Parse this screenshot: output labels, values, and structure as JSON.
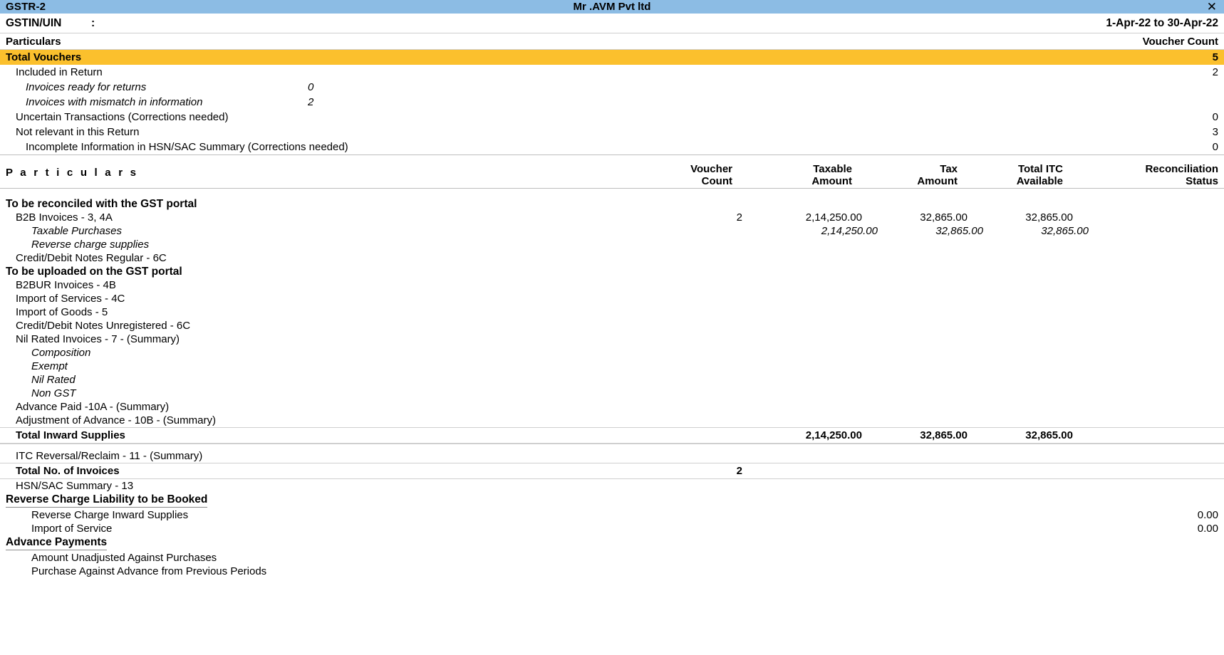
{
  "titlebar": {
    "report_name": "GSTR-2",
    "company": "Mr .AVM  Pvt ltd",
    "close_icon": "close-icon",
    "close_glyph": "✕"
  },
  "header": {
    "gstin_label": "GSTIN/UIN",
    "gstin_colon": ":",
    "gstin_value": "",
    "period": "1-Apr-22 to 30-Apr-22",
    "particulars_label": "Particulars",
    "voucher_count_label": "Voucher Count"
  },
  "summary": {
    "total_vouchers": {
      "label": "Total Vouchers",
      "value": "5"
    },
    "rows": [
      {
        "label": "Included in Return",
        "indent": 1,
        "italic": false,
        "sub_value": "",
        "value": "2"
      },
      {
        "label": "Invoices ready for returns",
        "indent": 2,
        "italic": true,
        "sub_value": "0",
        "value": ""
      },
      {
        "label": "Invoices with mismatch in information",
        "indent": 2,
        "italic": true,
        "sub_value": "2",
        "value": ""
      },
      {
        "label": "Uncertain Transactions (Corrections needed)",
        "indent": 1,
        "italic": false,
        "sub_value": "",
        "value": "0"
      },
      {
        "label": "Not relevant in this Return",
        "indent": 1,
        "italic": false,
        "sub_value": "",
        "value": "3"
      },
      {
        "label": "Incomplete Information in HSN/SAC Summary (Corrections needed)",
        "indent": 2,
        "italic": false,
        "sub_value": "",
        "value": "0"
      }
    ]
  },
  "table": {
    "columns": {
      "particulars": "P a r t i c u l a r s",
      "voucher_count_l1": "Voucher",
      "voucher_count_l2": "Count",
      "taxable_amount_l1": "Taxable",
      "taxable_amount_l2": "Amount",
      "tax_amount_l1": "Tax",
      "tax_amount_l2": "Amount",
      "total_itc_l1": "Total ITC",
      "total_itc_l2": "Available",
      "reconciliation_l1": "Reconciliation",
      "reconciliation_l2": "Status"
    },
    "rows": [
      {
        "label": "To be reconciled with the GST portal",
        "style": "bold",
        "indent": 0,
        "vc": "",
        "taxable": "",
        "tax": "",
        "itc": "",
        "recon": ""
      },
      {
        "label": "B2B Invoices - 3, 4A",
        "style": "normal",
        "indent": 1,
        "vc": "2",
        "taxable": "2,14,250.00",
        "tax": "32,865.00",
        "itc": "32,865.00",
        "recon": ""
      },
      {
        "label": "Taxable Purchases",
        "style": "italic",
        "indent": 2,
        "vc": "",
        "taxable": "2,14,250.00",
        "tax": "32,865.00",
        "itc": "32,865.00",
        "recon": ""
      },
      {
        "label": "Reverse charge supplies",
        "style": "italic",
        "indent": 2,
        "vc": "",
        "taxable": "",
        "tax": "",
        "itc": "",
        "recon": ""
      },
      {
        "label": "Credit/Debit Notes Regular - 6C",
        "style": "normal",
        "indent": 1,
        "vc": "",
        "taxable": "",
        "tax": "",
        "itc": "",
        "recon": ""
      },
      {
        "label": "To be uploaded on the GST portal",
        "style": "bold",
        "indent": 0,
        "vc": "",
        "taxable": "",
        "tax": "",
        "itc": "",
        "recon": ""
      },
      {
        "label": "B2BUR Invoices - 4B",
        "style": "normal",
        "indent": 1,
        "vc": "",
        "taxable": "",
        "tax": "",
        "itc": "",
        "recon": ""
      },
      {
        "label": "Import of Services - 4C",
        "style": "normal",
        "indent": 1,
        "vc": "",
        "taxable": "",
        "tax": "",
        "itc": "",
        "recon": ""
      },
      {
        "label": "Import of Goods - 5",
        "style": "normal",
        "indent": 1,
        "vc": "",
        "taxable": "",
        "tax": "",
        "itc": "",
        "recon": ""
      },
      {
        "label": "Credit/Debit Notes Unregistered - 6C",
        "style": "normal",
        "indent": 1,
        "vc": "",
        "taxable": "",
        "tax": "",
        "itc": "",
        "recon": ""
      },
      {
        "label": "Nil Rated Invoices - 7 - (Summary)",
        "style": "normal",
        "indent": 1,
        "vc": "",
        "taxable": "",
        "tax": "",
        "itc": "",
        "recon": ""
      },
      {
        "label": "Composition",
        "style": "italic",
        "indent": 2,
        "vc": "",
        "taxable": "",
        "tax": "",
        "itc": "",
        "recon": ""
      },
      {
        "label": "Exempt",
        "style": "italic",
        "indent": 2,
        "vc": "",
        "taxable": "",
        "tax": "",
        "itc": "",
        "recon": ""
      },
      {
        "label": "Nil Rated",
        "style": "italic",
        "indent": 2,
        "vc": "",
        "taxable": "",
        "tax": "",
        "itc": "",
        "recon": ""
      },
      {
        "label": "Non GST",
        "style": "italic",
        "indent": 2,
        "vc": "",
        "taxable": "",
        "tax": "",
        "itc": "",
        "recon": ""
      },
      {
        "label": "Advance Paid -10A - (Summary)",
        "style": "normal",
        "indent": 1,
        "vc": "",
        "taxable": "",
        "tax": "",
        "itc": "",
        "recon": ""
      },
      {
        "label": "Adjustment of Advance - 10B - (Summary)",
        "style": "normal",
        "indent": 1,
        "vc": "",
        "taxable": "",
        "tax": "",
        "itc": "",
        "recon": ""
      }
    ],
    "total_inward": {
      "label": "Total Inward Supplies",
      "vc": "",
      "taxable": "2,14,250.00",
      "tax": "32,865.00",
      "itc": "32,865.00",
      "recon": ""
    },
    "itc_reversal": {
      "label": "ITC Reversal/Reclaim - 11 - (Summary)",
      "vc": "",
      "taxable": "",
      "tax": "",
      "itc": "",
      "recon": ""
    },
    "total_invoices": {
      "label": "Total No. of Invoices",
      "vc": "2",
      "taxable": "",
      "tax": "",
      "itc": "",
      "recon": ""
    },
    "hsn_summary": {
      "label": "HSN/SAC Summary - 13",
      "vc": "",
      "taxable": "",
      "tax": "",
      "itc": "",
      "recon": ""
    }
  },
  "reverse_charge": {
    "heading": "Reverse Charge Liability to be Booked",
    "rows": [
      {
        "label": "Reverse Charge Inward Supplies",
        "value": "0.00"
      },
      {
        "label": "Import of Service",
        "value": "0.00"
      }
    ]
  },
  "advance_payments": {
    "heading": "Advance Payments",
    "rows": [
      {
        "label": "Amount Unadjusted Against Purchases",
        "value": ""
      },
      {
        "label": "Purchase Against Advance from Previous Periods",
        "value": ""
      }
    ]
  },
  "colors": {
    "titlebar": "#8cbce4",
    "highlight": "#fbc02d",
    "text": "#000000"
  }
}
